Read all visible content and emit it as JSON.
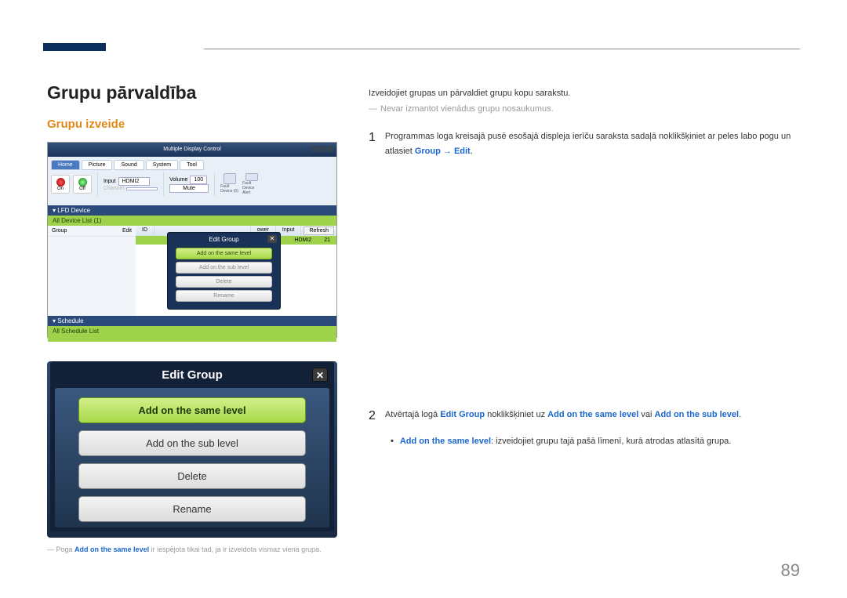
{
  "header": {
    "title": "Grupu pārvaldība",
    "subtitle": "Grupu izveide"
  },
  "right": {
    "intro": "Izveidojiet grupas un pārvaldiet grupu kopu sarakstu.",
    "note": "Nevar izmantot vienādus grupu nosaukumus.",
    "step1_pre": "Programmas loga kreisajā pusē esošajā displeja ierīču saraksta sadaļā noklikšķiniet ar peles labo pogu un atlasiet ",
    "group": "Group",
    "arrow_edit": " → Edit",
    "period": ".",
    "step2_a": "Atvērtajā logā ",
    "step2_edit": "Edit Group",
    "step2_b": " noklikšķiniet uz ",
    "same": "Add on the same level",
    "vai": " vai ",
    "sub": "Add on the sub level",
    "bullet_rest": ": izveidojiet grupu tajā pašā līmenī, kurā atrodas atlasītā grupa."
  },
  "footnote": {
    "pre": "Poga ",
    "same": "Add on the same level",
    "post": " ir iespējota tikai tad, ja ir izveidota vismaz viena grupa."
  },
  "shot1": {
    "title": "Multiple Display Control",
    "tabs": [
      "Home",
      "Picture",
      "Sound",
      "System",
      "Tool"
    ],
    "on": "On",
    "off": "Off",
    "input": "Input",
    "input_v": "HDMI2",
    "channel": "Channel",
    "volume": "Volume",
    "vol_v": "100",
    "mute": "Mute",
    "fd1": "Fault Device (0)",
    "fd2": "Fault Device Alert",
    "lfd": "LFD Device",
    "alldev": "All Device List (1)",
    "refresh": "Refresh",
    "group": "Group",
    "edit": "Edit",
    "th_id": "ID",
    "th_pwr": "ower",
    "th_inp": "Input",
    "th_v": "21",
    "row_inp": "HDMI2",
    "popup_title": "Edit Group",
    "p_same": "Add on the same level",
    "p_sub": "Add on the sub level",
    "p_del": "Delete",
    "p_ren": "Rename",
    "schedule": "Schedule",
    "allsch": "All Schedule List"
  },
  "shot2": {
    "title": "Edit Group",
    "same": "Add on the same level",
    "sub": "Add on the sub level",
    "del": "Delete",
    "ren": "Rename"
  },
  "pagenum": "89"
}
